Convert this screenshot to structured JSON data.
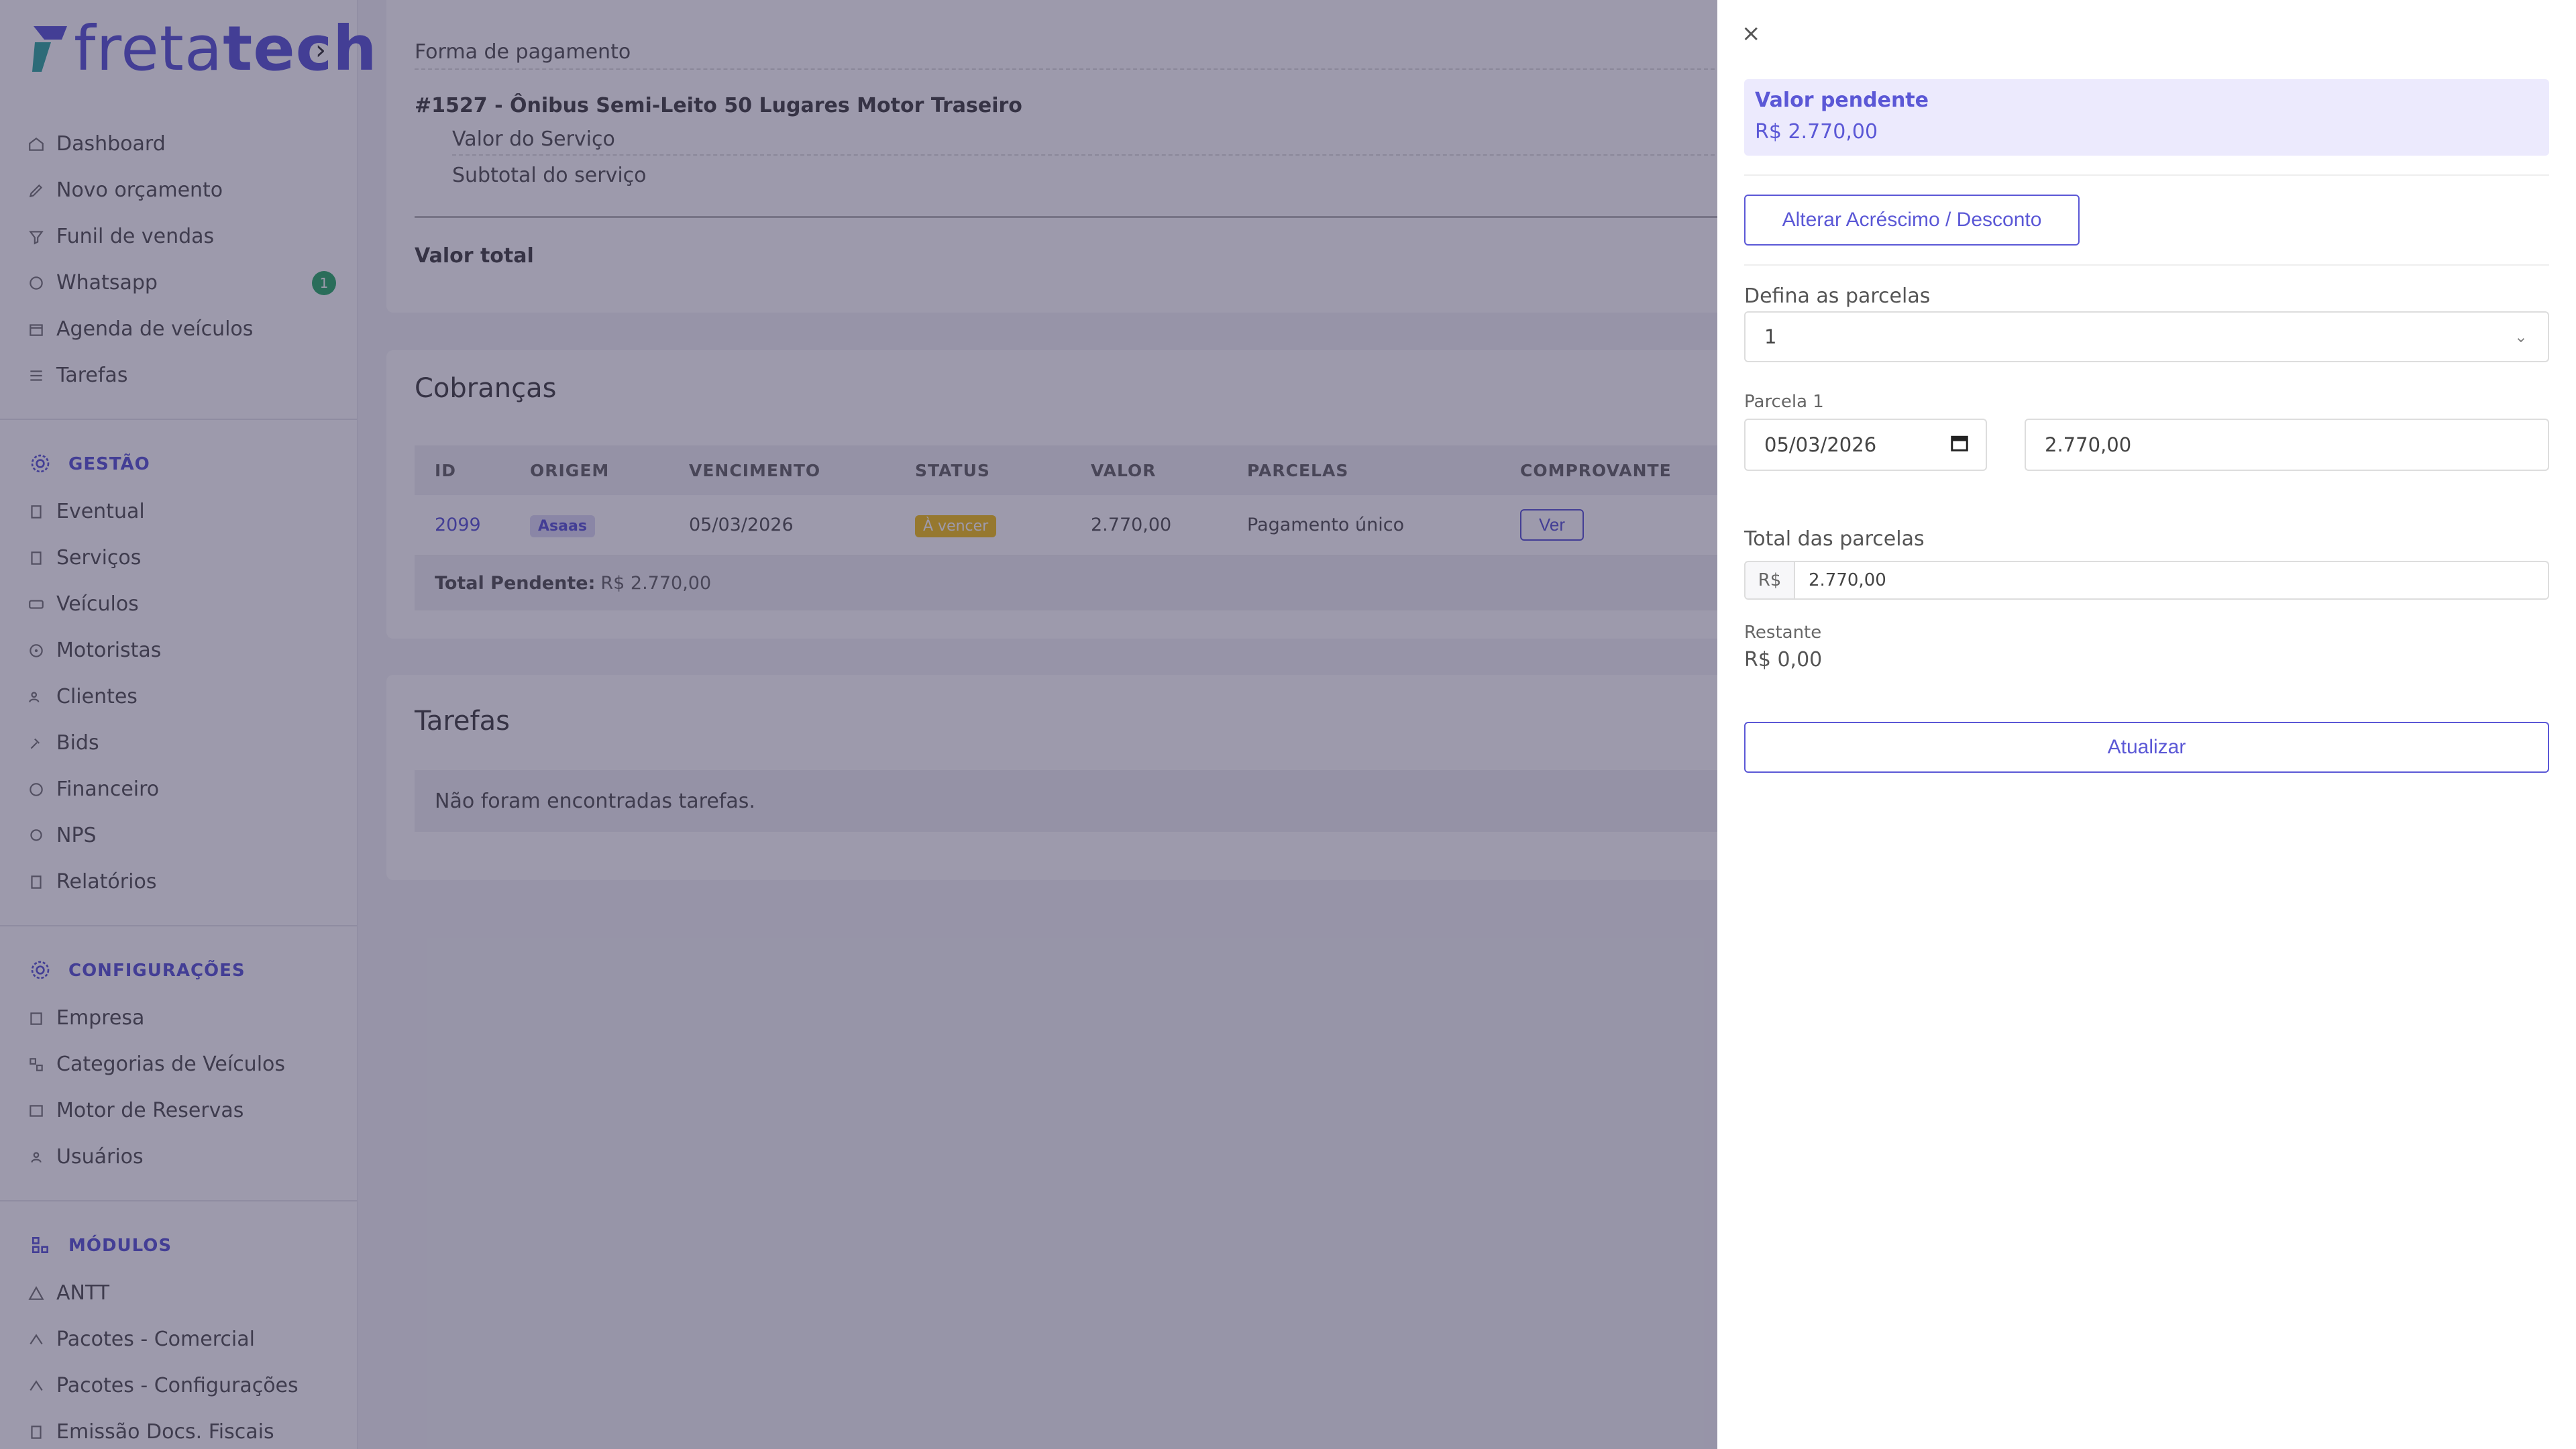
{
  "app": {
    "logo_text_light": "freta",
    "logo_text_bold": "tech",
    "colors": {
      "brand": "#5b58d6",
      "badge": "#2eae6b",
      "warning": "#f3c11c"
    }
  },
  "sidebar": {
    "main_items": [
      {
        "label": "Dashboard",
        "icon": "home-icon"
      },
      {
        "label": "Novo orçamento",
        "icon": "edit-icon"
      },
      {
        "label": "Funil de vendas",
        "icon": "funnel-icon"
      },
      {
        "label": "Whatsapp",
        "icon": "whatsapp-icon",
        "badge": "1"
      },
      {
        "label": "Agenda de veículos",
        "icon": "calendar-icon"
      },
      {
        "label": "Tarefas",
        "icon": "list-icon"
      }
    ],
    "gestao_title": "GESTÃO",
    "gestao_items": [
      {
        "label": "Eventual"
      },
      {
        "label": "Serviços"
      },
      {
        "label": "Veículos"
      },
      {
        "label": "Motoristas"
      },
      {
        "label": "Clientes"
      },
      {
        "label": "Bids"
      },
      {
        "label": "Financeiro"
      },
      {
        "label": "NPS"
      },
      {
        "label": "Relatórios"
      }
    ],
    "config_title": "CONFIGURAÇÕES",
    "config_items": [
      {
        "label": "Empresa"
      },
      {
        "label": "Categorias de Veículos"
      },
      {
        "label": "Motor de Reservas"
      },
      {
        "label": "Usuários"
      }
    ],
    "modulos_title": "MÓDULOS",
    "modulos_items": [
      {
        "label": "ANTT"
      },
      {
        "label": "Pacotes - Comercial"
      },
      {
        "label": "Pacotes - Configurações"
      },
      {
        "label": "Emissão Docs. Fiscais"
      }
    ]
  },
  "summary": {
    "payment_label": "Forma de pagamento",
    "service_title": "#1527 - Ônibus Semi-Leito 50 Lugares Motor Traseiro",
    "service_value_label": "Valor do Serviço",
    "subtotal_label": "Subtotal do serviço",
    "total_label": "Valor total"
  },
  "cobrancas": {
    "title": "Cobranças",
    "headers": [
      "ID",
      "ORIGEM",
      "VENCIMENTO",
      "STATUS",
      "VALOR",
      "PARCELAS",
      "COMPROVANTE"
    ],
    "row": {
      "id": "2099",
      "origem": "Asaas",
      "vencimento": "05/03/2026",
      "status": "À vencer",
      "valor": "2.770,00",
      "parcelas": "Pagamento único",
      "comprovante": "Ver"
    },
    "total_label": "Total Pendente:",
    "total_value": "R$ 2.770,00"
  },
  "tarefas": {
    "title": "Tarefas",
    "empty": "Não foram encontradas tarefas."
  },
  "drawer": {
    "close": "×",
    "pending_title": "Valor pendente",
    "pending_value": "R$ 2.770,00",
    "adjust_button": "Alterar Acréscimo / Desconto",
    "installments_label": "Defina as parcelas",
    "installments_value": "1",
    "parcela_label": "Parcela 1",
    "parcela_date": "05/03/2026",
    "parcela_amount": "2.770,00",
    "total_label": "Total das parcelas",
    "currency_prefix": "R$",
    "total_value": "2.770,00",
    "remaining_label": "Restante",
    "remaining_value": "R$ 0,00",
    "update_button": "Atualizar"
  }
}
